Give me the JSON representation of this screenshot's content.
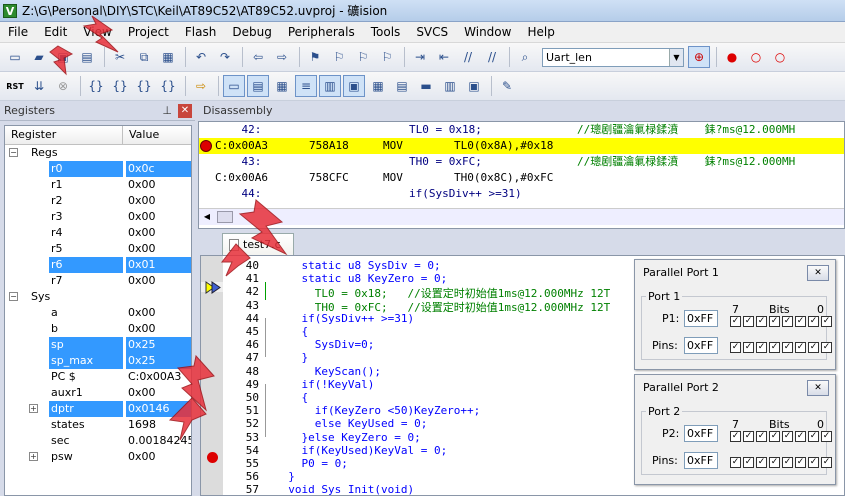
{
  "window": {
    "title": "Z:\\G\\Personal\\DIY\\STC\\Keil\\AT89C52\\AT89C52.uvproj - 礦ision",
    "icon": "V"
  },
  "menu": [
    "File",
    "Edit",
    "View",
    "Project",
    "Flash",
    "Debug",
    "Peripherals",
    "Tools",
    "SVCS",
    "Window",
    "Help"
  ],
  "toolbar": {
    "target": "Uart_len",
    "rst_label": "RST"
  },
  "registers": {
    "panel_title": "Registers",
    "col_register": "Register",
    "col_value": "Value",
    "groups": [
      {
        "name": "Regs",
        "items": [
          {
            "name": "r0",
            "value": "0x0c",
            "selected": true
          },
          {
            "name": "r1",
            "value": "0x00",
            "selected": false
          },
          {
            "name": "r2",
            "value": "0x00",
            "selected": false
          },
          {
            "name": "r3",
            "value": "0x00",
            "selected": false
          },
          {
            "name": "r4",
            "value": "0x00",
            "selected": false
          },
          {
            "name": "r5",
            "value": "0x00",
            "selected": false
          },
          {
            "name": "r6",
            "value": "0x01",
            "selected": true
          },
          {
            "name": "r7",
            "value": "0x00",
            "selected": false
          }
        ]
      },
      {
        "name": "Sys",
        "items": [
          {
            "name": "a",
            "value": "0x00",
            "selected": false
          },
          {
            "name": "b",
            "value": "0x00",
            "selected": false
          },
          {
            "name": "sp",
            "value": "0x25",
            "selected": true
          },
          {
            "name": "sp_max",
            "value": "0x25",
            "selected": true
          },
          {
            "name": "PC  $",
            "value": "C:0x00A3",
            "selected": false
          },
          {
            "name": "auxr1",
            "value": "0x00",
            "selected": false
          },
          {
            "name": "dptr",
            "value": "0x0146",
            "selected": true,
            "expand": true
          },
          {
            "name": "states",
            "value": "1698",
            "selected": false
          },
          {
            "name": "sec",
            "value": "0.00184245",
            "selected": false
          },
          {
            "name": "psw",
            "value": "0x00",
            "selected": false,
            "expand": true
          }
        ]
      }
    ]
  },
  "disassembly": {
    "panel_title": "Disassembly",
    "lines": [
      {
        "a": "    42:",
        "b": "",
        "c": "TL0 = 0x18;",
        "d": "//璁剧疆瀹氭椂鍒濆    銇?ms@12.000MH",
        "cur": false
      },
      {
        "a": "C:0x00A3",
        "b": "758A18",
        "c": "MOV",
        "d": "TL0(0x8A),#0x18",
        "cur": true
      },
      {
        "a": "    43:",
        "b": "",
        "c": "TH0 = 0xFC;",
        "d": "//璁剧疆瀹氭椂鍒濆    銇?ms@12.000MH",
        "cur": false
      },
      {
        "a": "C:0x00A6",
        "b": "758CFC",
        "c": "MOV",
        "d": "TH0(0x8C),#0xFC",
        "cur": false
      },
      {
        "a": "    44:",
        "b": "",
        "c": "if(SysDiv++ >=31)",
        "d": "",
        "cur": false
      }
    ]
  },
  "editor": {
    "file_tab": "test7.c",
    "lines": [
      {
        "n": "40",
        "code": "    static u8 SysDiv = 0;"
      },
      {
        "n": "41",
        "code": "    static u8 KeyZero = 0;"
      },
      {
        "n": "42",
        "code": "      TL0 = 0x18;   //设置定时初始值1ms@12.000MHz 12T"
      },
      {
        "n": "43",
        "code": "      TH0 = 0xFC;   //设置定时初始值1ms@12.000MHz 12T"
      },
      {
        "n": "44",
        "code": "    if(SysDiv++ >=31)"
      },
      {
        "n": "45",
        "code": "    {"
      },
      {
        "n": "46",
        "code": "      SysDiv=0;"
      },
      {
        "n": "47",
        "code": "    }"
      },
      {
        "n": "48",
        "code": "      KeyScan();"
      },
      {
        "n": "49",
        "code": "    if(!KeyVal)"
      },
      {
        "n": "50",
        "code": "    {"
      },
      {
        "n": "51",
        "code": "      if(KeyZero <50)KeyZero++;"
      },
      {
        "n": "52",
        "code": "      else KeyUsed = 0;"
      },
      {
        "n": "53",
        "code": "    }else KeyZero = 0;"
      },
      {
        "n": "54",
        "code": "    if(KeyUsed)KeyVal = 0;"
      },
      {
        "n": "55",
        "code": "    P0 = 0;"
      },
      {
        "n": "56",
        "code": "  }"
      },
      {
        "n": "57",
        "code": "  void Sys_Init(void)"
      }
    ]
  },
  "port1": {
    "title": "Parallel Port 1",
    "group": "Port 1",
    "reg_label": "P1:",
    "reg_value": "0xFF",
    "pins_label": "Pins:",
    "pins_value": "0xFF",
    "bit_hi": "7",
    "bits_label": "Bits",
    "bit_lo": "0"
  },
  "port2": {
    "title": "Parallel Port 2",
    "group": "Port 2",
    "reg_label": "P2:",
    "reg_value": "0xFF",
    "pins_label": "Pins:",
    "pins_value": "0xFF",
    "bit_hi": "7",
    "bits_label": "Bits",
    "bit_lo": "0"
  },
  "colors": {
    "accent": "#3399ff",
    "current_line": "#ffff00",
    "breakpoint": "#dd0000"
  }
}
